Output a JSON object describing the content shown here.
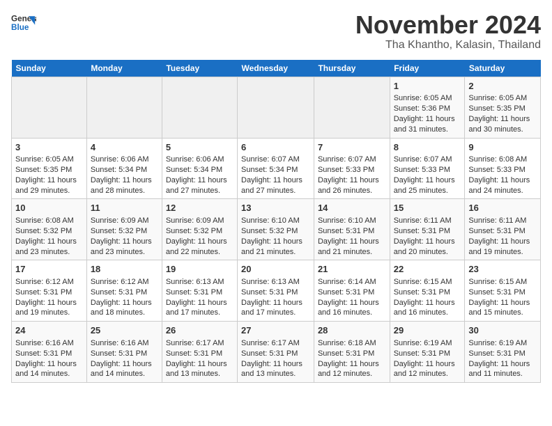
{
  "header": {
    "logo_general": "General",
    "logo_blue": "Blue",
    "month_title": "November 2024",
    "subtitle": "Tha Khantho, Kalasin, Thailand"
  },
  "weekdays": [
    "Sunday",
    "Monday",
    "Tuesday",
    "Wednesday",
    "Thursday",
    "Friday",
    "Saturday"
  ],
  "weeks": [
    [
      {
        "day": "",
        "info": ""
      },
      {
        "day": "",
        "info": ""
      },
      {
        "day": "",
        "info": ""
      },
      {
        "day": "",
        "info": ""
      },
      {
        "day": "",
        "info": ""
      },
      {
        "day": "1",
        "info": "Sunrise: 6:05 AM\nSunset: 5:36 PM\nDaylight: 11 hours and 31 minutes."
      },
      {
        "day": "2",
        "info": "Sunrise: 6:05 AM\nSunset: 5:35 PM\nDaylight: 11 hours and 30 minutes."
      }
    ],
    [
      {
        "day": "3",
        "info": "Sunrise: 6:05 AM\nSunset: 5:35 PM\nDaylight: 11 hours and 29 minutes."
      },
      {
        "day": "4",
        "info": "Sunrise: 6:06 AM\nSunset: 5:34 PM\nDaylight: 11 hours and 28 minutes."
      },
      {
        "day": "5",
        "info": "Sunrise: 6:06 AM\nSunset: 5:34 PM\nDaylight: 11 hours and 27 minutes."
      },
      {
        "day": "6",
        "info": "Sunrise: 6:07 AM\nSunset: 5:34 PM\nDaylight: 11 hours and 27 minutes."
      },
      {
        "day": "7",
        "info": "Sunrise: 6:07 AM\nSunset: 5:33 PM\nDaylight: 11 hours and 26 minutes."
      },
      {
        "day": "8",
        "info": "Sunrise: 6:07 AM\nSunset: 5:33 PM\nDaylight: 11 hours and 25 minutes."
      },
      {
        "day": "9",
        "info": "Sunrise: 6:08 AM\nSunset: 5:33 PM\nDaylight: 11 hours and 24 minutes."
      }
    ],
    [
      {
        "day": "10",
        "info": "Sunrise: 6:08 AM\nSunset: 5:32 PM\nDaylight: 11 hours and 23 minutes."
      },
      {
        "day": "11",
        "info": "Sunrise: 6:09 AM\nSunset: 5:32 PM\nDaylight: 11 hours and 23 minutes."
      },
      {
        "day": "12",
        "info": "Sunrise: 6:09 AM\nSunset: 5:32 PM\nDaylight: 11 hours and 22 minutes."
      },
      {
        "day": "13",
        "info": "Sunrise: 6:10 AM\nSunset: 5:32 PM\nDaylight: 11 hours and 21 minutes."
      },
      {
        "day": "14",
        "info": "Sunrise: 6:10 AM\nSunset: 5:31 PM\nDaylight: 11 hours and 21 minutes."
      },
      {
        "day": "15",
        "info": "Sunrise: 6:11 AM\nSunset: 5:31 PM\nDaylight: 11 hours and 20 minutes."
      },
      {
        "day": "16",
        "info": "Sunrise: 6:11 AM\nSunset: 5:31 PM\nDaylight: 11 hours and 19 minutes."
      }
    ],
    [
      {
        "day": "17",
        "info": "Sunrise: 6:12 AM\nSunset: 5:31 PM\nDaylight: 11 hours and 19 minutes."
      },
      {
        "day": "18",
        "info": "Sunrise: 6:12 AM\nSunset: 5:31 PM\nDaylight: 11 hours and 18 minutes."
      },
      {
        "day": "19",
        "info": "Sunrise: 6:13 AM\nSunset: 5:31 PM\nDaylight: 11 hours and 17 minutes."
      },
      {
        "day": "20",
        "info": "Sunrise: 6:13 AM\nSunset: 5:31 PM\nDaylight: 11 hours and 17 minutes."
      },
      {
        "day": "21",
        "info": "Sunrise: 6:14 AM\nSunset: 5:31 PM\nDaylight: 11 hours and 16 minutes."
      },
      {
        "day": "22",
        "info": "Sunrise: 6:15 AM\nSunset: 5:31 PM\nDaylight: 11 hours and 16 minutes."
      },
      {
        "day": "23",
        "info": "Sunrise: 6:15 AM\nSunset: 5:31 PM\nDaylight: 11 hours and 15 minutes."
      }
    ],
    [
      {
        "day": "24",
        "info": "Sunrise: 6:16 AM\nSunset: 5:31 PM\nDaylight: 11 hours and 14 minutes."
      },
      {
        "day": "25",
        "info": "Sunrise: 6:16 AM\nSunset: 5:31 PM\nDaylight: 11 hours and 14 minutes."
      },
      {
        "day": "26",
        "info": "Sunrise: 6:17 AM\nSunset: 5:31 PM\nDaylight: 11 hours and 13 minutes."
      },
      {
        "day": "27",
        "info": "Sunrise: 6:17 AM\nSunset: 5:31 PM\nDaylight: 11 hours and 13 minutes."
      },
      {
        "day": "28",
        "info": "Sunrise: 6:18 AM\nSunset: 5:31 PM\nDaylight: 11 hours and 12 minutes."
      },
      {
        "day": "29",
        "info": "Sunrise: 6:19 AM\nSunset: 5:31 PM\nDaylight: 11 hours and 12 minutes."
      },
      {
        "day": "30",
        "info": "Sunrise: 6:19 AM\nSunset: 5:31 PM\nDaylight: 11 hours and 11 minutes."
      }
    ]
  ]
}
